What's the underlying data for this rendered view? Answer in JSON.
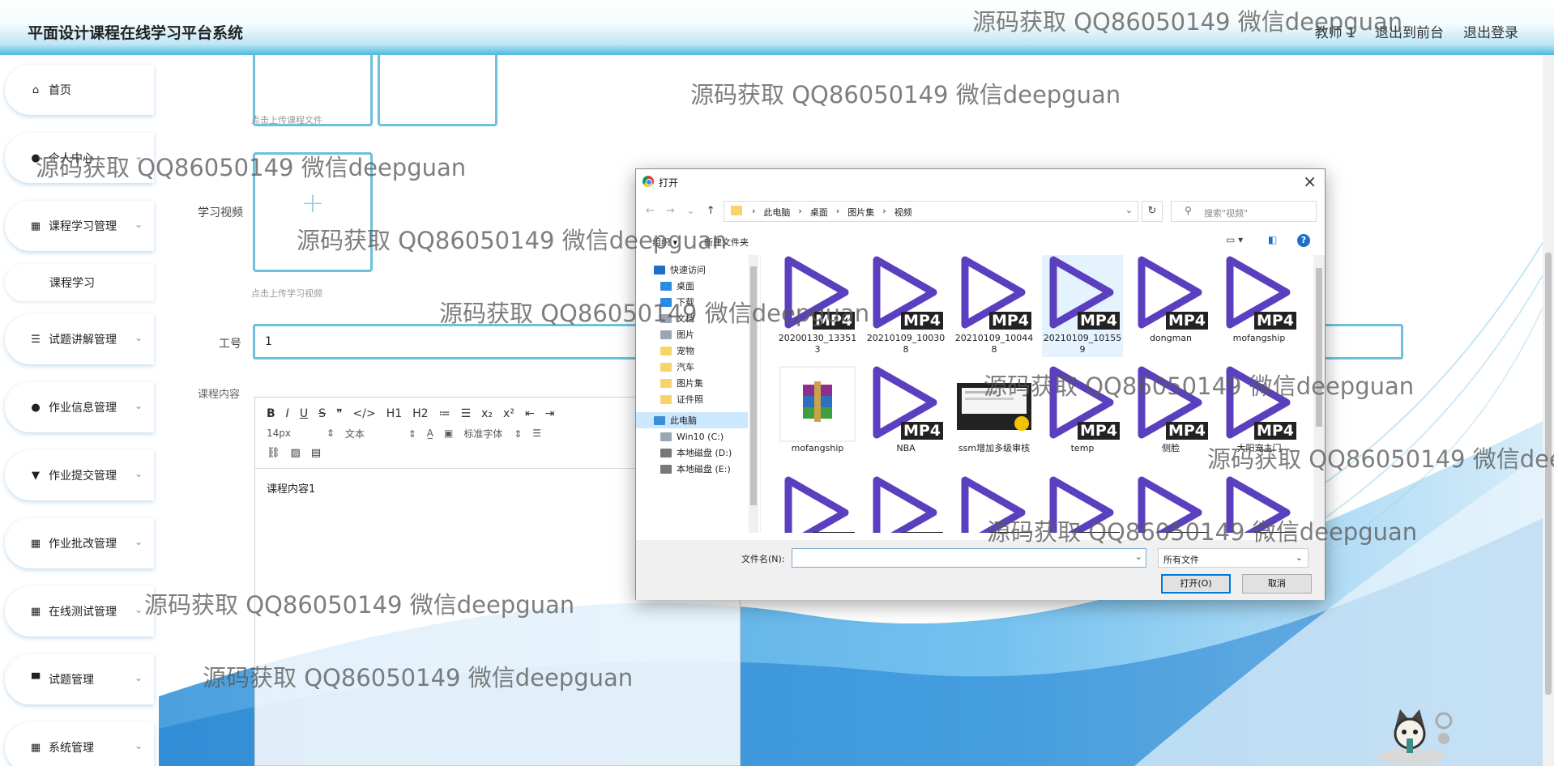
{
  "app": {
    "title": "平面设计课程在线学习平台系统"
  },
  "header": {
    "user": "教师 1",
    "to_front": "退出到前台",
    "logout": "退出登录"
  },
  "sidebar": {
    "items": [
      {
        "label": "首页",
        "icon": "home-icon",
        "glyph": "⌂"
      },
      {
        "label": "个人中心",
        "icon": "user-icon",
        "glyph": "●"
      },
      {
        "label": "课程学习管理",
        "icon": "grid-icon",
        "glyph": "▦"
      },
      {
        "label": "课程学习",
        "icon": "",
        "glyph": ""
      },
      {
        "label": "试题讲解管理",
        "icon": "list-icon",
        "glyph": "☰"
      },
      {
        "label": "作业信息管理",
        "icon": "user-icon",
        "glyph": "●"
      },
      {
        "label": "作业提交管理",
        "icon": "pin-icon",
        "glyph": "▼"
      },
      {
        "label": "作业批改管理",
        "icon": "grid-icon",
        "glyph": "▦"
      },
      {
        "label": "在线测试管理",
        "icon": "grid-icon",
        "glyph": "▦"
      },
      {
        "label": "试题管理",
        "icon": "monitor-icon",
        "glyph": "▀"
      },
      {
        "label": "系统管理",
        "icon": "grid-icon",
        "glyph": "▦"
      }
    ]
  },
  "form": {
    "course_file_hint": "点击上传课程文件",
    "video_label": "学习视频",
    "video_hint": "点击上传学习视频",
    "job_no_label": "工号",
    "job_no_value": "1",
    "content_label": "课程内容",
    "editor": {
      "row1": [
        "B",
        "I",
        "U",
        "S",
        "❞",
        "</>",
        "H1",
        "H2",
        "≔",
        "☰",
        "x₂",
        "x²",
        "⇤",
        "⇥"
      ],
      "font_size": "14px",
      "block_type": "文本",
      "font_family": "标准字体",
      "content": "课程内容1"
    }
  },
  "dialog": {
    "title": "打开",
    "breadcrumb": [
      "此电脑",
      "桌面",
      "图片集",
      "视频"
    ],
    "search_placeholder": "搜索\"视频\"",
    "organize": "组织 ▾",
    "new_folder": "新建文件夹",
    "tree": [
      {
        "label": "快速访问",
        "color": "#1e6fc8",
        "indent": 22
      },
      {
        "label": "桌面",
        "color": "#2b8be0",
        "indent": 30
      },
      {
        "label": "下载",
        "color": "#2b8be0",
        "indent": 30
      },
      {
        "label": "文档",
        "color": "#9aa6b3",
        "indent": 30
      },
      {
        "label": "图片",
        "color": "#9aa6b3",
        "indent": 30
      },
      {
        "label": "宠物",
        "color": "#f7d36a",
        "indent": 30
      },
      {
        "label": "汽车",
        "color": "#f7d36a",
        "indent": 30
      },
      {
        "label": "图片集",
        "color": "#f7d36a",
        "indent": 30
      },
      {
        "label": "证件照",
        "color": "#f7d36a",
        "indent": 30
      },
      {
        "label": "此电脑",
        "color": "#3b8fd6",
        "indent": 22
      },
      {
        "label": "Win10 (C:)",
        "color": "#9aa6b3",
        "indent": 30
      },
      {
        "label": "本地磁盘 (D:)",
        "color": "#777777",
        "indent": 30
      },
      {
        "label": "本地磁盘 (E:)",
        "color": "#777777",
        "indent": 30
      }
    ],
    "files": [
      {
        "name": "20200130_133513",
        "type": "mp4"
      },
      {
        "name": "20210109_100308",
        "type": "mp4"
      },
      {
        "name": "20210109_100448",
        "type": "mp4"
      },
      {
        "name": "20210109_101559",
        "type": "mp4"
      },
      {
        "name": "dongman",
        "type": "mp4"
      },
      {
        "name": "mofangship",
        "type": "mp4"
      },
      {
        "name": "mofangship",
        "type": "rar"
      },
      {
        "name": "NBA",
        "type": "mp4"
      },
      {
        "name": "ssm增加多级审核",
        "type": "video"
      },
      {
        "name": "temp",
        "type": "mp4"
      },
      {
        "name": "侧脸",
        "type": "mp4"
      },
      {
        "name": "大阳宠主门",
        "type": "mp4"
      },
      {
        "name": "",
        "type": "mp4"
      },
      {
        "name": "",
        "type": "mp4"
      },
      {
        "name": "",
        "type": "mp4"
      },
      {
        "name": "",
        "type": "mp4"
      },
      {
        "name": "",
        "type": "mp4"
      },
      {
        "name": "",
        "type": "mp4"
      }
    ],
    "mp4_badge": "MP4",
    "filename_label": "文件名(N):",
    "filetype": "所有文件",
    "open_btn": "打开(O)",
    "cancel_btn": "取消"
  },
  "watermark": "源码获取 QQ86050149 微信deepguan",
  "colors": {
    "accent": "#4cb8e0",
    "border": "#6ec0dc",
    "play": "#5a3fbf"
  }
}
